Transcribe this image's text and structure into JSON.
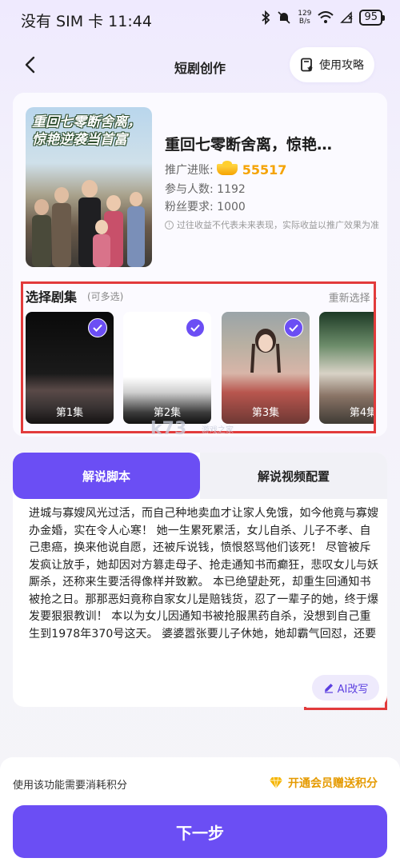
{
  "status_bar": {
    "left": "没有 SIM 卡 11:44",
    "net_speed": "129\nB/s",
    "battery": "95"
  },
  "nav": {
    "title": "短剧创作",
    "guide_label": "使用攻略"
  },
  "drama": {
    "poster_title": "重回七零断舍离，惊艳逆袭当首富",
    "title": "重回七零断舍离，惊艳…",
    "progress_label": "推广进账:",
    "progress_value": "55517",
    "participants": "参与人数: 1192",
    "fans_required": "粉丝要求: 1000",
    "disclaimer": "过往收益不代表未来表现，实际收益以推广效果为准"
  },
  "episodes": {
    "title": "选择剧集",
    "subtitle": "(可多选)",
    "reselect": "重新选择",
    "items": [
      {
        "label": "第1集",
        "checked": true
      },
      {
        "label": "第2集",
        "checked": true
      },
      {
        "label": "第3集",
        "checked": true
      },
      {
        "label": "第4集",
        "checked": false
      }
    ]
  },
  "watermark": {
    "main": "k73",
    "sub": "游戏之家"
  },
  "tabs": [
    {
      "label": "解说脚本",
      "active": true
    },
    {
      "label": "解说视频配置",
      "active": false
    }
  ],
  "script_text": "进城与寡嫂风光过活，而自己种地卖血才让家人免饿，如今他竟与寡嫂办金婚，实在令人心寒！ 她一生累死累活，女儿自杀、儿子不孝、自己患癌，换来他说自愿，还被斥说钱，愤恨怒骂他们该死！ 尽管被斥发疯让放手，她却因对方篡走母子、抢走通知书而癫狂，悲叹女儿与妖厮杀，还称来生要活得像样并致歉。 本已绝望赴死，却重生回通知书被抢之日。那那恶妇竟称自家女儿是赔钱货，忍了一辈子的她，终于爆发要狠狠教训！ 本以为女儿因通知书被抢服黑药自杀，没想到自己重生到1978年370号这天。 婆婆嚣张要儿子休她，她却霸气回怼，还要先休了丈夫！ 兰兰母亲欲护其录取通知书，婆婆却要抢走，称兰兰是赔钱货不配上学，还以让儿子",
  "ai_button": "AI改写",
  "footer": {
    "points_note": "使用该功能需要消耗积分",
    "member_link": "开通会员赠送积分",
    "next_button": "下一步"
  },
  "colors": {
    "accent": "#6b4ef4",
    "gold": "#f5a300",
    "highlight_box": "#e23b3b"
  }
}
